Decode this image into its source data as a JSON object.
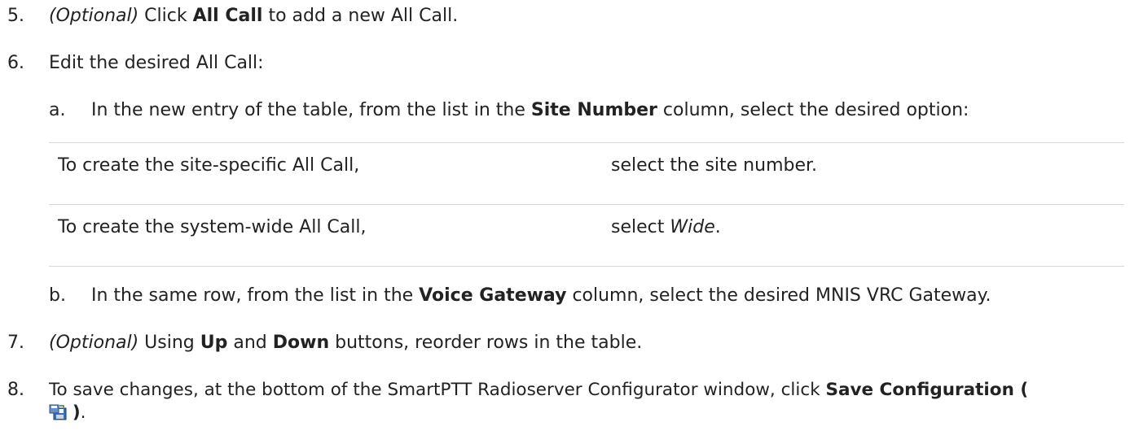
{
  "steps": [
    {
      "num": "5.",
      "optional": "(Optional)",
      "pre": " Click ",
      "bold": "All Call",
      "post": " to add a new All Call."
    },
    {
      "num": "6.",
      "text": "Edit the desired All Call:"
    },
    {
      "num": "7.",
      "optional": "(Optional)",
      "pre": " Using ",
      "bold1": "Up",
      "mid": " and ",
      "bold2": "Down",
      "post": " buttons, reorder rows in the table."
    },
    {
      "num": "8.",
      "pre": "To save changes, at the bottom of the SmartPTT Radioserver Configurator window, click ",
      "bold": "Save Configuration (",
      "post_bold": ")",
      "post": "."
    }
  ],
  "substeps": [
    {
      "letter": "a.",
      "pre": "In the new entry of the table, from the list in the ",
      "bold": "Site Number",
      "post": " column, select the desired option:"
    },
    {
      "letter": "b.",
      "pre": "In the same row, from the list in the ",
      "bold": "Voice Gateway",
      "post": " column, select the desired MNIS VRC Gateway."
    }
  ],
  "table": {
    "rows": [
      {
        "condition": "To create the site-specific All Call,",
        "action_pre": "select the site number.",
        "action_italic": "",
        "action_post": ""
      },
      {
        "condition": "To create the system-wide All Call,",
        "action_pre": "select ",
        "action_italic": "Wide",
        "action_post": "."
      }
    ]
  },
  "icons": {
    "save": "save-configuration-icon"
  }
}
